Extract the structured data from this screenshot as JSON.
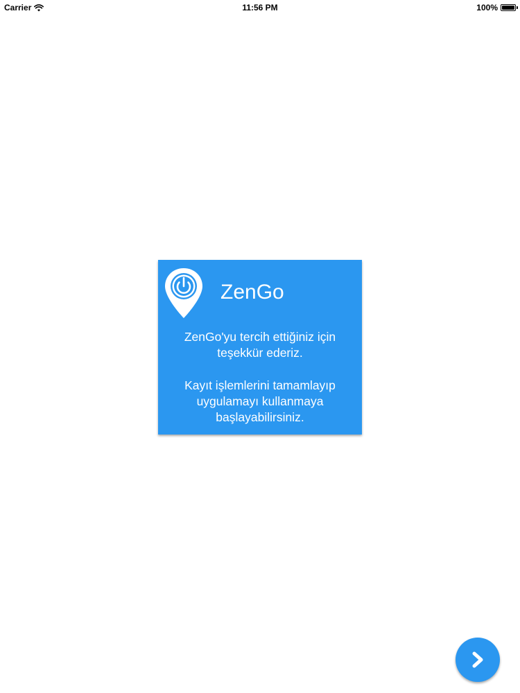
{
  "status_bar": {
    "carrier": "Carrier",
    "time": "11:56 PM",
    "battery_percent": "100%",
    "battery_level": 1.0,
    "wifi_icon": "wifi-icon",
    "battery_icon": "battery-icon"
  },
  "card": {
    "title": "ZenGo",
    "logo_icon": "location-pin-power-icon",
    "message_one_lines": [
      "ZenGo'yu tercih ettiğiniz için",
      "teşekkür ederiz."
    ],
    "message_two_lines": [
      "Kayıt işlemlerini tamamlayıp",
      "uygulamayı kullanmaya",
      "başlayabilirsiniz."
    ]
  },
  "next_button": {
    "icon": "chevron-right-icon"
  },
  "colors": {
    "accent": "#2b97f0",
    "background": "#ffffff",
    "text_on_accent": "#ffffff"
  }
}
